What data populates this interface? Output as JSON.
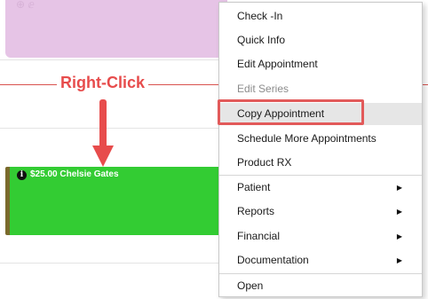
{
  "annotation": {
    "label": "Right-Click",
    "color": "#e74c4c"
  },
  "appointments": {
    "top_block": {
      "ghost_text": "⊕ ⅇ",
      "color": "#e6c4e6"
    },
    "green_block": {
      "label": "$25.00 Chelsie Gates",
      "icon": "info-icon",
      "color": "#33cc33"
    }
  },
  "context_menu": {
    "items": [
      {
        "label": "Check -In"
      },
      {
        "label": "Quick Info"
      },
      {
        "label": "Edit Appointment"
      },
      {
        "label": "Edit Series",
        "disabled": true
      },
      {
        "label": "Copy Appointment",
        "highlighted": true
      },
      {
        "label": "Schedule More Appointments"
      },
      {
        "label": "Product RX"
      },
      {
        "label": "Patient",
        "submenu": true
      },
      {
        "label": "Reports",
        "submenu": true
      },
      {
        "label": "Financial",
        "submenu": true
      },
      {
        "label": "Documentation",
        "submenu": true
      },
      {
        "label": "Open"
      }
    ],
    "submenu_arrow_glyph": "▶"
  }
}
